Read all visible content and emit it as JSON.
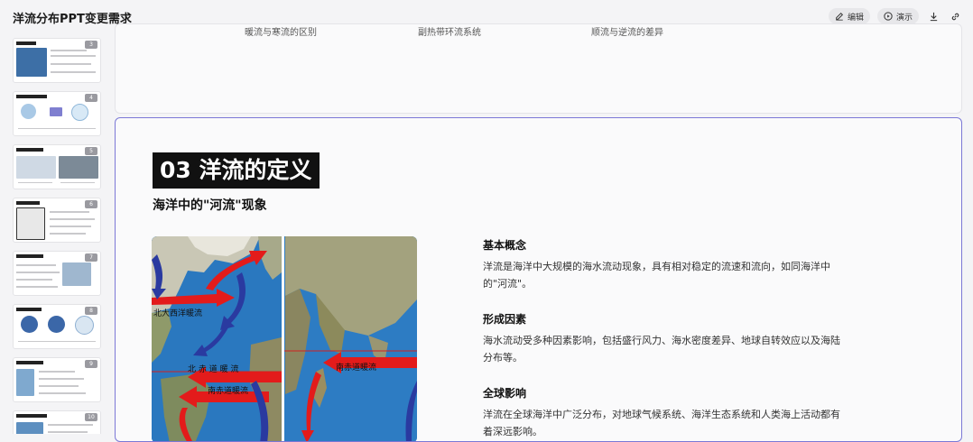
{
  "app": {
    "title": "洋流分布PPT变更需求",
    "edit_label": "编辑",
    "present_label": "演示"
  },
  "thumbnails": [
    {
      "num": "3"
    },
    {
      "num": "4"
    },
    {
      "num": "5"
    },
    {
      "num": "6"
    },
    {
      "num": "7"
    },
    {
      "num": "8"
    },
    {
      "num": "9"
    },
    {
      "num": "10"
    }
  ],
  "prev_slide": {
    "captions": [
      "暖流与寒流的区别",
      "副热带环流系统",
      "顺流与逆流的差异"
    ]
  },
  "slide": {
    "title": "03 洋流的定义",
    "subtitle": "海洋中的\"河流\"现象",
    "map_labels": {
      "north_atlantic_drift": "北大西洋暖流",
      "north_equatorial": "北 赤 道 暖 流",
      "south_equatorial": "南赤道暖流",
      "south_equatorial_2": "南赤道暖流"
    },
    "sections": [
      {
        "heading": "基本概念",
        "text": "洋流是海洋中大规模的海水流动现象，具有相对稳定的流速和流向，如同海洋中的\"河流\"。"
      },
      {
        "heading": "形成因素",
        "text": "海水流动受多种因素影响，包括盛行风力、海水密度差异、地球自转效应以及海陆分布等。"
      },
      {
        "heading": "全球影响",
        "text": "洋流在全球海洋中广泛分布，对地球气候系统、海洋生态系统和人类海上活动都有着深远影响。"
      }
    ]
  }
}
